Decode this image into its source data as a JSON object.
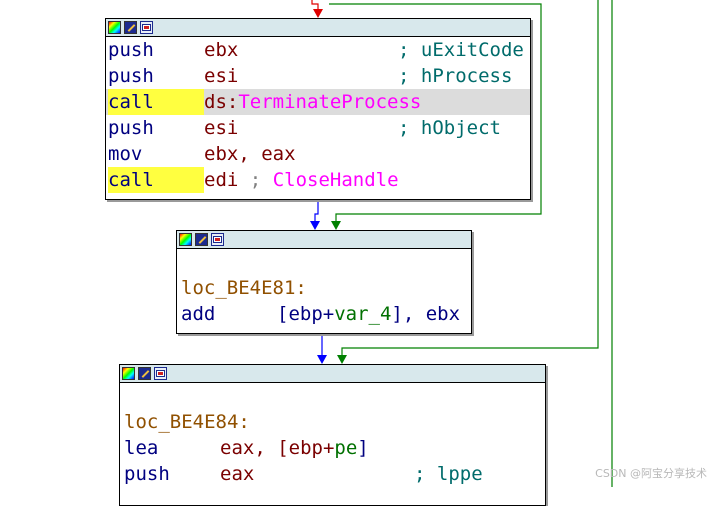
{
  "graph": {
    "block1": {
      "lines": [
        {
          "mn": "push",
          "op": "ebx",
          "comment": "; uExitCode"
        },
        {
          "mn": "push",
          "op": "esi",
          "comment": "; hProcess"
        },
        {
          "mn": "call",
          "seg": "ds:",
          "api": "TerminateProcess"
        },
        {
          "mn": "push",
          "op": "esi",
          "comment": "; hObject"
        },
        {
          "mn": "mov",
          "op": "ebx, eax"
        },
        {
          "mn": "call",
          "op": "edi",
          "semi": ";",
          "api": "CloseHandle"
        }
      ]
    },
    "block2": {
      "label": "loc_BE4E81:",
      "add": {
        "mn": "add",
        "open": "[ebp+",
        "var": "var_4",
        "close": "], ebx"
      }
    },
    "block3": {
      "label": "loc_BE4E84:",
      "lea": {
        "mn": "lea",
        "op": "eax, [ebp+",
        "var": "pe",
        "close": "]"
      },
      "push": {
        "mn": "push",
        "op": "eax",
        "comment": "; lppe"
      }
    }
  },
  "colors": {
    "edge_red": "#e00000",
    "edge_blue": "#0000ff",
    "edge_green": "#008000",
    "titlebar": "#d8e8ec",
    "call_highlight": "#ffff40",
    "line_highlight": "#dcdcdc"
  },
  "icons": [
    "color-palette-icon",
    "edit-pencil-icon",
    "graph-overview-icon"
  ],
  "watermark": "CSDN @阿宝分享技术"
}
